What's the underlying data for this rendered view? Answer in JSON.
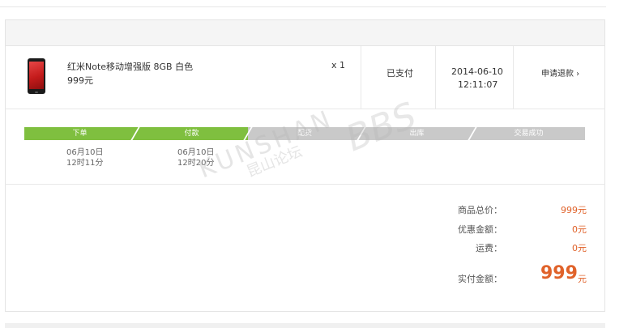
{
  "order_item": {
    "product_name": "红米Note移动增强版 8GB 白色",
    "price": "999元",
    "quantity": "x 1",
    "status": "已支付",
    "date": "2014-06-10",
    "time": "12:11:07",
    "refund_label": "申请退款 ›"
  },
  "progress": {
    "steps": [
      {
        "label": "下单",
        "date": "06月10日",
        "time": "12时11分",
        "done": true
      },
      {
        "label": "付款",
        "date": "06月10日",
        "time": "12时20分",
        "done": true
      },
      {
        "label": "配货",
        "date": "",
        "time": "",
        "done": false
      },
      {
        "label": "出库",
        "date": "",
        "time": "",
        "done": false
      },
      {
        "label": "交易成功",
        "date": "",
        "time": "",
        "done": false
      }
    ]
  },
  "summary": {
    "subtotal_label": "商品总价：",
    "subtotal_value": "999元",
    "discount_label": "优惠金额：",
    "discount_value": "0元",
    "shipping_label": "运费：",
    "shipping_value": "0元",
    "paid_label": "实付金额：",
    "paid_value": "999",
    "paid_unit": "元"
  },
  "watermark": {
    "text1": "KUNSHAN",
    "text2": "BBS",
    "text3": "昆山论坛"
  },
  "colors": {
    "accent_orange": "#e0622a",
    "progress_done": "#7fbf3f",
    "progress_todo": "#c9c9c9"
  }
}
